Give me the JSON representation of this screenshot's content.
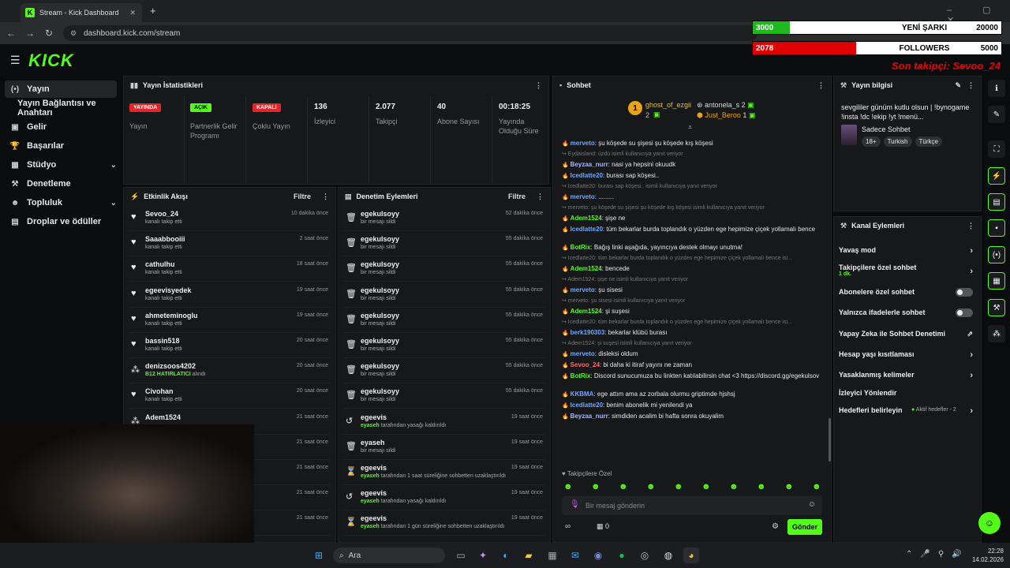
{
  "browser": {
    "tab_title": "Stream - Kick Dashboard",
    "url": "dashboard.kick.com/stream"
  },
  "overlay": {
    "song_value": "3000",
    "song_label": "YENİ ŞARKI",
    "song_goal": "20000",
    "song_progress": 0.15,
    "followers_value": "2078",
    "followers_label": "FOLLOWERS",
    "followers_goal": "5000",
    "followers_progress": 0.4156,
    "last_follower": "Son takipçi: Sevoo_24"
  },
  "sidebar": {
    "items": [
      {
        "label": "Yayın",
        "icon": "broadcast-icon"
      },
      {
        "label": "Yayın Bağlantısı ve Anahtarı",
        "icon": ""
      },
      {
        "label": "Gelir",
        "icon": "wallet-icon"
      },
      {
        "label": "Başarılar",
        "icon": "trophy-icon"
      },
      {
        "label": "Stüdyo",
        "icon": "studio-icon"
      },
      {
        "label": "Denetleme",
        "icon": "hammer-icon"
      },
      {
        "label": "Topluluk",
        "icon": "community-icon"
      },
      {
        "label": "Droplar ve ödüller",
        "icon": "drops-icon"
      }
    ]
  },
  "stats": {
    "title": "Yayın İstatistikleri",
    "items": [
      {
        "badge": "YAYINDA",
        "label": "Yayın"
      },
      {
        "badge": "AÇIK",
        "label": "Partnerlik Gelir Programı"
      },
      {
        "badge": "KAPALI",
        "label": "Çoklu Yayın"
      },
      {
        "value": "136",
        "label": "İzleyici"
      },
      {
        "value": "2.077",
        "label": "Takipçi"
      },
      {
        "value": "40",
        "label": "Abone Sayısı"
      },
      {
        "value": "00:18:25",
        "label": "Yayında Olduğu Süre"
      }
    ]
  },
  "activity": {
    "title": "Etkinlik Akışı",
    "filter": "Filtre",
    "rows": [
      {
        "name": "Sevoo_24",
        "sub": "kanalı takip etti",
        "time": "10 dakika önce",
        "icon": "heart-icon"
      },
      {
        "name": "Saaabbooiii",
        "sub": "kanalı takip etti",
        "time": "2 saat önce",
        "icon": "heart-icon"
      },
      {
        "name": "cathulhu",
        "sub": "kanalı takip etti",
        "time": "18 saat önce",
        "icon": "heart-icon"
      },
      {
        "name": "egeevisyedek",
        "sub": "kanalı takip etti",
        "time": "19 saat önce",
        "icon": "heart-icon"
      },
      {
        "name": "ahmetеminoglu",
        "sub": "kanalı takip etti",
        "time": "19 saat önce",
        "icon": "heart-icon"
      },
      {
        "name": "bassin518",
        "sub": "kanalı takip etti",
        "time": "20 saat önce",
        "icon": "heart-icon"
      },
      {
        "name": "denizsoos4202",
        "sub_green": "B12 HATIRLATICI",
        "sub": " alındı",
        "time": "20 saat önce",
        "icon": "drop-icon"
      },
      {
        "name": "Civohan",
        "sub": "kanalı takip etti",
        "time": "20 saat önce",
        "icon": "heart-icon"
      },
      {
        "name": "Adem1524",
        "sub": "",
        "time": "21 saat önce",
        "icon": "drop-icon"
      },
      {
        "name": "",
        "sub": "",
        "time": "21 saat önce",
        "icon": ""
      },
      {
        "name": "",
        "sub": "",
        "time": "21 saat önce",
        "icon": ""
      },
      {
        "name": "",
        "sub": "",
        "time": "21 saat önce",
        "icon": ""
      },
      {
        "name": "",
        "sub": "",
        "time": "21 saat önce",
        "icon": ""
      }
    ]
  },
  "moderation": {
    "title": "Denetim Eylemleri",
    "filter": "Filtre",
    "rows": [
      {
        "name": "egekulsoyy",
        "sub": "bir mesajı sildi",
        "time": "52 dakika önce",
        "icon": "trash-icon"
      },
      {
        "name": "egekulsoyy",
        "sub": "bir mesajı sildi",
        "time": "55 dakika önce",
        "icon": "trash-icon"
      },
      {
        "name": "egekulsoyy",
        "sub": "bir mesajı sildi",
        "time": "55 dakika önce",
        "icon": "trash-icon"
      },
      {
        "name": "egekulsoyy",
        "sub": "bir mesajı sildi",
        "time": "55 dakika önce",
        "icon": "trash-icon"
      },
      {
        "name": "egekulsoyy",
        "sub": "bir mesajı sildi",
        "time": "55 dakika önce",
        "icon": "trash-icon"
      },
      {
        "name": "egekulsoyy",
        "sub": "bir mesajı sildi",
        "time": "55 dakika önce",
        "icon": "trash-icon"
      },
      {
        "name": "egekulsoyy",
        "sub": "bir mesajı sildi",
        "time": "55 dakika önce",
        "icon": "trash-icon"
      },
      {
        "name": "egekulsoyy",
        "sub": "bir mesajı sildi",
        "time": "55 dakika önce",
        "icon": "trash-icon"
      },
      {
        "name": "egeevis",
        "sub_green": "eyaseh",
        "sub": " tarafından yasağı kaldırıldı",
        "time": "19 saat önce",
        "icon": "undo-icon"
      },
      {
        "name": "eyaseh",
        "sub": "bir mesajı sildi",
        "time": "19 saat önce",
        "icon": "trash-icon"
      },
      {
        "name": "egeevis",
        "sub_green": "eyaseh",
        "sub": " tarafından 1 saat süreliğine sohbetten uzaklaştırıldı",
        "time": "19 saat önce",
        "icon": "hourglass-icon"
      },
      {
        "name": "egeevis",
        "sub_green": "eyaseh",
        "sub": " tarafından yasağı kaldırıldı",
        "time": "19 saat önce",
        "icon": "undo-icon"
      },
      {
        "name": "egeevis",
        "sub_green": "eyaseh",
        "sub": " tarafından 1 gün süreliğine sohbetten uzaklaştırıldı",
        "time": "19 saat önce",
        "icon": "hourglass-icon"
      }
    ]
  },
  "chat": {
    "title": "Sohbet",
    "top_gifters": [
      {
        "name": "ghost_of_ezgii",
        "count": "2"
      },
      {
        "name": "antonela_s",
        "count": "2"
      },
      {
        "name": "Just_Beroo",
        "count": "1"
      }
    ],
    "messages": [
      {
        "user": "merveto",
        "color": "#6ea8ff",
        "text": ": şu köşede su şişesi şu köşede kış köşesi",
        "reply": false
      },
      {
        "user": "",
        "color": "",
        "text": "↪ Eydaisland: üzdü isimli kullanıcıya yanıt veriyor",
        "reply": true
      },
      {
        "user": "Beyzaa_nurr",
        "color": "#a8b8ff",
        "text": ": nasi ya hepsini okuudk",
        "reply": false
      },
      {
        "user": "Icedlatte20",
        "color": "#6ea8ff",
        "text": ": burası sap köşesi..",
        "reply": false
      },
      {
        "user": "",
        "color": "",
        "text": "↪ Icedlatte20: burası sap köşesi.. isimli kullanıcıya yanıt veriyor",
        "reply": true
      },
      {
        "user": "merveto",
        "color": "#6ea8ff",
        "text": ": .........",
        "reply": false
      },
      {
        "user": "",
        "color": "",
        "text": "↪ merveto: şu köşede su şişesi şu köşede kış köşesi isimli kullanıcıya yanıt veriyor",
        "reply": true
      },
      {
        "user": "Adem1524",
        "color": "#53fc18",
        "text": ": şişe ne",
        "reply": false
      },
      {
        "user": "Icedlatte20",
        "color": "#6ea8ff",
        "text": ": tüm bekarlar burda toplandık o yüzden ege hepimize çiçek yollamalı bence",
        "reply": false
      },
      {
        "user": "BotRix",
        "color": "#53fc18",
        "text": ": Bağış linki aşağıda, yayıncıya destek olmayı unutma!",
        "reply": false
      },
      {
        "user": "",
        "color": "",
        "text": "↪ Icedlatte20: tüm bekarlar burda toplandık o yüzden ege hepimize çiçek yollamalı bence isi...",
        "reply": true
      },
      {
        "user": "Adem1524",
        "color": "#53fc18",
        "text": ": bencede",
        "reply": false
      },
      {
        "user": "",
        "color": "",
        "text": "↪ Adem1524: şişe ne isimli kullanıcıya yanıt veriyor",
        "reply": true
      },
      {
        "user": "merveto",
        "color": "#6ea8ff",
        "text": ": şu sisesi",
        "reply": false
      },
      {
        "user": "",
        "color": "",
        "text": "↪ merveto: şu sisesi isimli kullanıcıya yanıt veriyor",
        "reply": true
      },
      {
        "user": "Adem1524",
        "color": "#53fc18",
        "text": ": şi suşesi",
        "reply": false
      },
      {
        "user": "",
        "color": "",
        "text": "↪ Icedlatte20: tüm bekarlar burda toplandık o yüzden ege hepimize çiçek yollamalı bence isi...",
        "reply": true
      },
      {
        "user": "berk190303",
        "color": "#6ea8ff",
        "text": ": bekarlar klübü burası",
        "reply": false
      },
      {
        "user": "",
        "color": "",
        "text": "↪ Adem1524: şi suşesi isimli kullanıcıya yanıt veriyor",
        "reply": true
      },
      {
        "user": "merveto",
        "color": "#6ea8ff",
        "text": ": disleksi oldum",
        "reply": false
      },
      {
        "user": "Sevoo_24",
        "color": "#ff6b6b",
        "text": ": bi daha ki itiraf yayını ne zaman",
        "reply": false
      },
      {
        "user": "BotRix",
        "color": "#53fc18",
        "text": ": Discord sunucumuza bu linkten katılabilirsin chat <3 https://discord.gg/egekulsov",
        "reply": false
      },
      {
        "user": "KKBMA",
        "color": "#6ea8ff",
        "text": ": ege attım ama az zorbala olurmu griptimde hjshsj",
        "reply": false
      },
      {
        "user": "Icedlatte20",
        "color": "#6ea8ff",
        "text": ": benim abonelik mi yenilendi ya",
        "reply": false
      },
      {
        "user": "Beyzaa_nurr",
        "color": "#a8b8ff",
        "text": ": simdiden acalim bi hafta sonra okuyalim",
        "reply": false
      }
    ],
    "followers_only": "Takipçilere Özel",
    "input_placeholder": "Bir mesaj gönderin",
    "points": "0",
    "send_label": "Gönder"
  },
  "stream_info": {
    "title": "Yayın bilgisi",
    "description": "sevgililer günüm kutlu olsun | !bynogame !insta !dc !ekip !yt !menü...",
    "category": "Sadece Sohbet",
    "tags": [
      "18+",
      "Turkish",
      "Türkçe"
    ]
  },
  "channel_actions": {
    "title": "Kanal Eylemleri",
    "items": [
      {
        "label": "Yavaş mod",
        "type": "arrow"
      },
      {
        "label": "Takipçilere özel sohbet",
        "sub": "1 dk.",
        "type": "arrow"
      },
      {
        "label": "Abonelere özel sohbet",
        "type": "toggle"
      },
      {
        "label": "Yalnızca ifadelerle sohbet",
        "type": "toggle"
      },
      {
        "label": "Yapay Zeka ile Sohbet Denetimi",
        "type": "external"
      },
      {
        "label": "Hesap yaşı kısıtlaması",
        "type": "arrow"
      },
      {
        "label": "Yasaklanmış kelimeler",
        "type": "arrow"
      },
      {
        "label": "İzleyici Yönlendir",
        "type": "none"
      },
      {
        "label": "Hedefleri belirleyin",
        "sub": "Aktif hedefler - 2",
        "type": "arrow"
      }
    ]
  },
  "taskbar": {
    "search": "Ara",
    "time": "22:28",
    "date": "14.02.2026"
  }
}
